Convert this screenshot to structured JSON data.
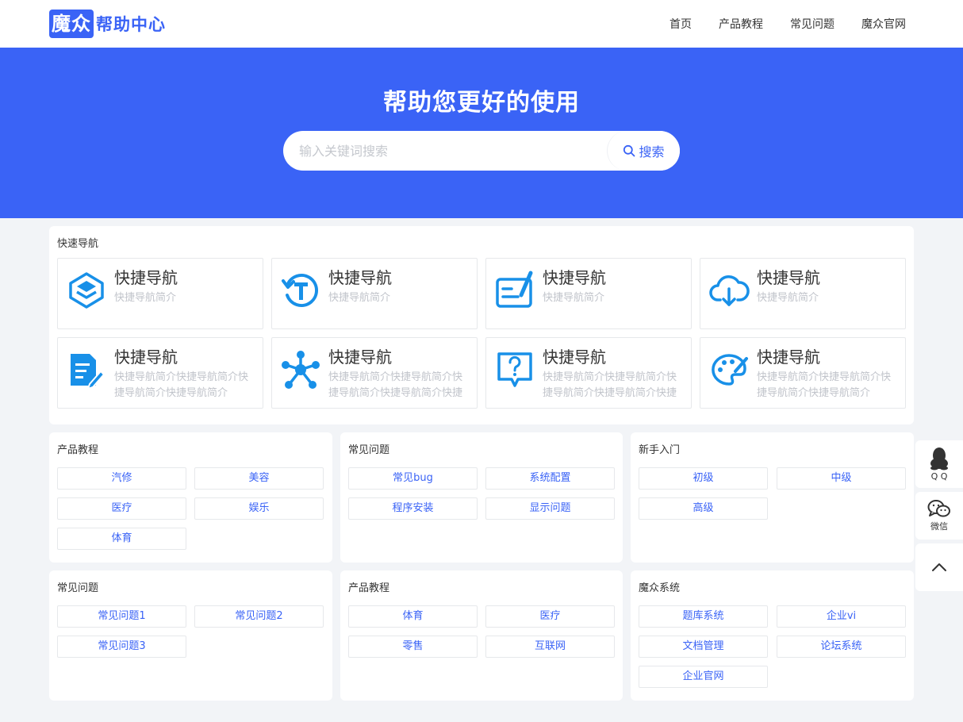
{
  "header": {
    "logo_box": "魔众",
    "logo_text": "帮助中心",
    "nav": [
      "首页",
      "产品教程",
      "常见问题",
      "魔众官网"
    ]
  },
  "banner": {
    "title": "帮助您更好的使用",
    "search_placeholder": "输入关键词搜索",
    "search_button": "搜索"
  },
  "quick_nav": {
    "title": "快速导航",
    "items": [
      {
        "title": "快捷导航",
        "desc": "快捷导航简介",
        "icon": "layers-icon"
      },
      {
        "title": "快捷导航",
        "desc": "快捷导航简介",
        "icon": "refresh-icon"
      },
      {
        "title": "快捷导航",
        "desc": "快捷导航简介",
        "icon": "edit-icon"
      },
      {
        "title": "快捷导航",
        "desc": "快捷导航简介",
        "icon": "cloud-download-icon"
      },
      {
        "title": "快捷导航",
        "desc": "快捷导航简介快捷导航简介快捷导航简介快捷导航简介",
        "icon": "document-edit-icon"
      },
      {
        "title": "快捷导航",
        "desc": "快捷导航简介快捷导航简介快捷导航简介快捷导航简介快捷",
        "icon": "molecule-icon"
      },
      {
        "title": "快捷导航",
        "desc": "快捷导航简介快捷导航简介快捷导航简介快捷导航简介快捷",
        "icon": "question-icon"
      },
      {
        "title": "快捷导航",
        "desc": "快捷导航简介快捷导航简介快捷导航简介快捷导航简介",
        "icon": "palette-icon"
      }
    ]
  },
  "categories": [
    {
      "title": "产品教程",
      "tags": [
        "汽修",
        "美容",
        "医疗",
        "娱乐",
        "体育"
      ]
    },
    {
      "title": "常见问题",
      "tags": [
        "常见bug",
        "系统配置",
        "程序安装",
        "显示问题"
      ]
    },
    {
      "title": "新手入门",
      "tags": [
        "初级",
        "中级",
        "高级"
      ]
    },
    {
      "title": "常见问题",
      "tags": [
        "常见问题1",
        "常见问题2",
        "常见问题3"
      ]
    },
    {
      "title": "产品教程",
      "tags": [
        "体育",
        "医疗",
        "零售",
        "互联网"
      ]
    },
    {
      "title": "魔众系统",
      "tags": [
        "题库系统",
        "企业vi",
        "文档管理",
        "论坛系统",
        "企业官网"
      ]
    }
  ],
  "side": {
    "qq": "Q Q",
    "wechat": "微信"
  },
  "colors": {
    "accent": "#3a63f6",
    "icon_blue": "#1890e8",
    "background": "#f2f4f7"
  }
}
